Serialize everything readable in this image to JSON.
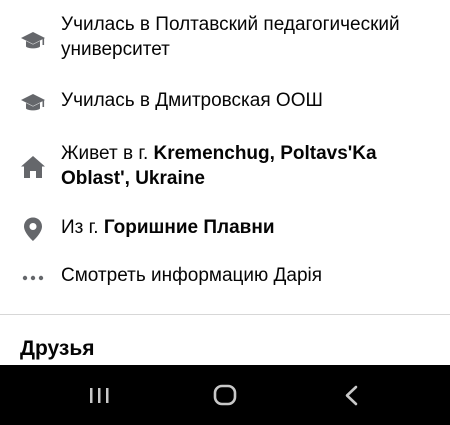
{
  "profile_intro": {
    "study_1": {
      "prefix": "Училась в Полтавский педагогический университет"
    },
    "study_2": {
      "prefix": "Училась в Дмитровская ООШ"
    },
    "lives": {
      "prefix": "Живет в г. ",
      "place": "Kremenchug, Poltavs'Ka Oblast', Ukraine"
    },
    "from": {
      "prefix": "Из г. ",
      "place": "Горишние Плавни"
    },
    "more": {
      "label": "Смотреть информацию Дарія"
    }
  },
  "friends_section": {
    "title": "Друзья"
  },
  "icons": {
    "study": "graduation-cap-icon",
    "home": "home-icon",
    "location": "location-pin-icon",
    "more": "more-dots-icon"
  },
  "colors": {
    "icon_gray": "#65676b",
    "text": "#050505",
    "nav_bar": "#000000",
    "nav_icon": "#c8c8c8"
  }
}
